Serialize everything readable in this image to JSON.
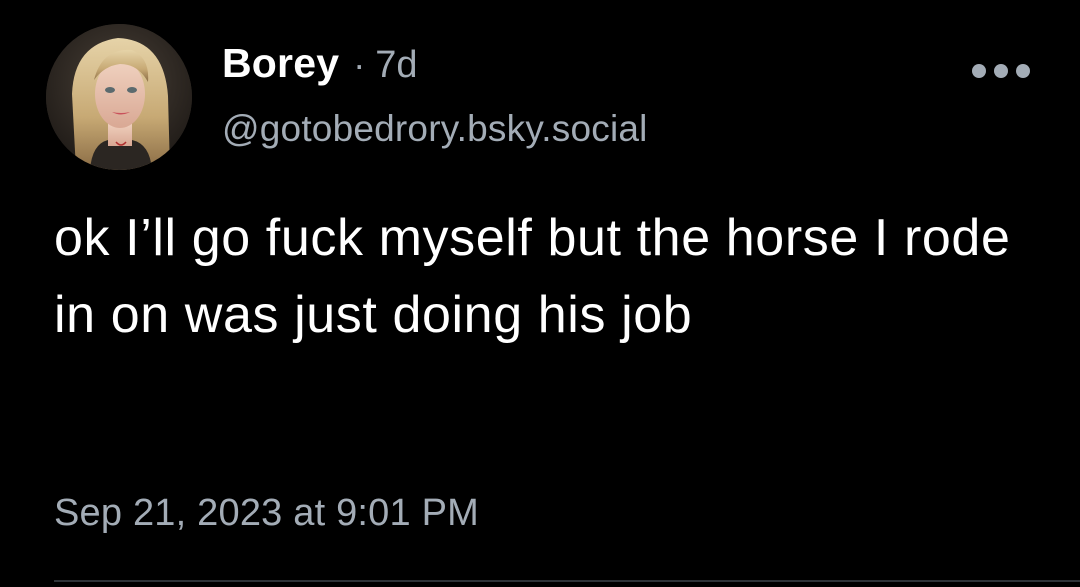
{
  "post": {
    "author": {
      "display_name": "Borey",
      "handle": "@gotobedrory.bsky.social",
      "avatar": "profile-photo"
    },
    "separator": "·",
    "age": "7d",
    "text": "ok I’ll go fuck myself but the horse I rode in on was just doing his job",
    "timestamp": "Sep 21, 2023 at 9:01 PM",
    "more_icon": "ellipsis-icon"
  },
  "colors": {
    "background": "#000000",
    "primary_text": "#ffffff",
    "secondary_text": "#a3acb6",
    "divider": "#2e3338"
  }
}
